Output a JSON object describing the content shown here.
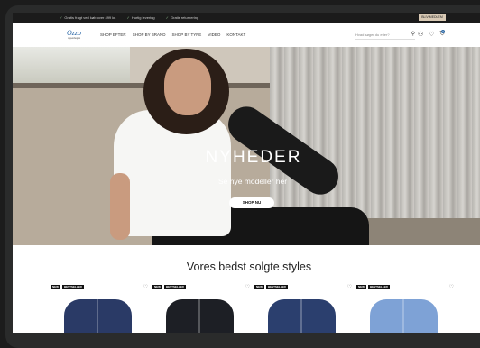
{
  "topbar": {
    "usps": [
      "Gratis fragt ved køb over 499 kr.",
      "Hurtig levering",
      "Gratis returnering"
    ],
    "cta": "BLIV MEDLEM"
  },
  "header": {
    "logo": "Ozzo",
    "logo_sub": "copenhagen",
    "menu": [
      "SHOP EFTER",
      "SHOP BY BRAND",
      "SHOP BY TYPE",
      "VIDEO",
      "KONTAKT"
    ],
    "search_placeholder": "Hvad søger du efter?",
    "cart_count": "0"
  },
  "hero": {
    "title": "NYHEDER",
    "subtitle": "Se nye modeller her",
    "button": "SHOP NU"
  },
  "bestsellers": {
    "title": "Vores bedst solgte styles",
    "products": [
      {
        "badges": [
          "NEW",
          "BESTSELLER"
        ],
        "color": "#2a3a66"
      },
      {
        "badges": [
          "NEW",
          "BESTSELLER"
        ],
        "color": "#1d1f25"
      },
      {
        "badges": [
          "NEW",
          "BESTSELLER"
        ],
        "color": "#2b3f6e"
      },
      {
        "badges": [
          "NEW",
          "BESTSELLER"
        ],
        "color": "#7ea2d6"
      }
    ]
  }
}
